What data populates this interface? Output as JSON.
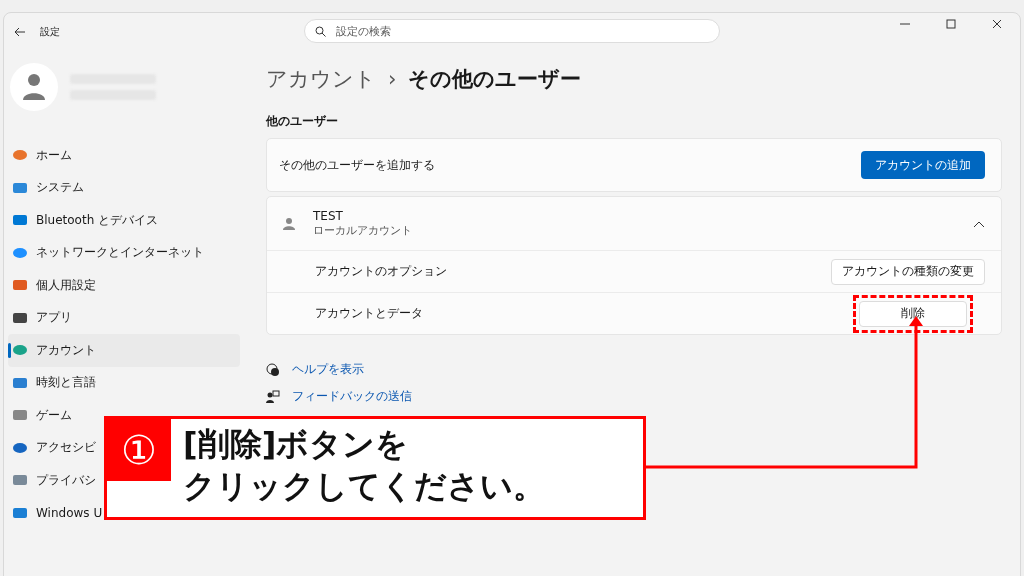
{
  "window": {
    "title": "設定",
    "search_placeholder": "設定の検索"
  },
  "sidebar": {
    "items": [
      {
        "label": "ホーム",
        "selected": false
      },
      {
        "label": "システム",
        "selected": false
      },
      {
        "label": "Bluetooth とデバイス",
        "selected": false
      },
      {
        "label": "ネットワークとインターネット",
        "selected": false
      },
      {
        "label": "個人用設定",
        "selected": false
      },
      {
        "label": "アプリ",
        "selected": false
      },
      {
        "label": "アカウント",
        "selected": true
      },
      {
        "label": "時刻と言語",
        "selected": false
      },
      {
        "label": "ゲーム",
        "selected": false
      },
      {
        "label": "アクセシビ",
        "selected": false
      },
      {
        "label": "プライバシ",
        "selected": false
      },
      {
        "label": "Windows U",
        "selected": false
      }
    ]
  },
  "breadcrumb": {
    "parent": "アカウント",
    "separator": "›",
    "current": "その他のユーザー"
  },
  "section_title": "他のユーザー",
  "add_user": {
    "label": "その他のユーザーを追加する",
    "button": "アカウントの追加"
  },
  "user": {
    "name": "TEST",
    "type": "ローカルアカウント",
    "expanded": true,
    "options": [
      {
        "label": "アカウントのオプション",
        "button": "アカウントの種類の変更",
        "highlighted": false
      },
      {
        "label": "アカウントとデータ",
        "button": "削除",
        "highlighted": true
      }
    ]
  },
  "links": [
    "ヘルプを表示",
    "フィードバックの送信"
  ],
  "callout": {
    "number": "①",
    "lines": [
      "[削除]ボタンを",
      "クリックしてください。"
    ]
  }
}
